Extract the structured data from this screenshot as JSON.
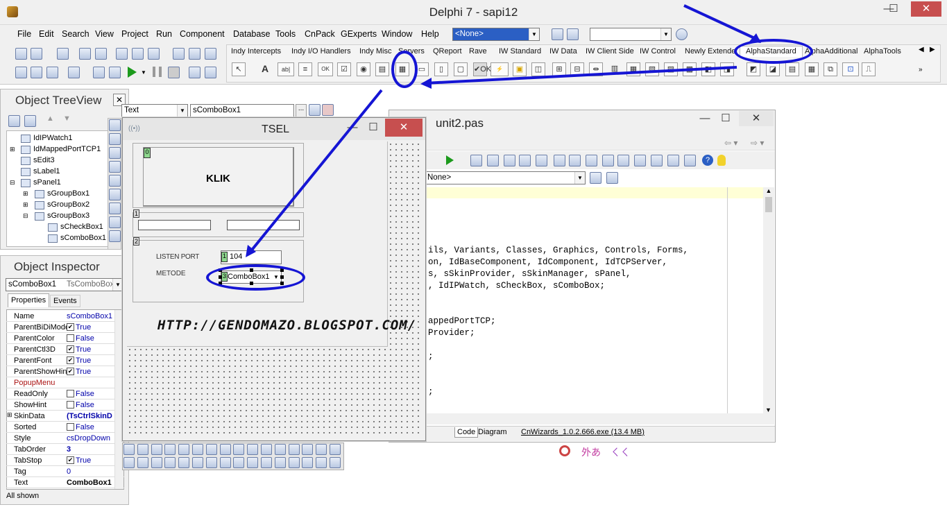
{
  "window": {
    "title": "Delphi 7 - sapi12",
    "minimize": "—",
    "maximize": "☐",
    "close": "✕"
  },
  "menu": [
    "File",
    "Edit",
    "Search",
    "View",
    "Project",
    "Run",
    "Component",
    "Database",
    "Tools",
    "CnPack",
    "GExperts",
    "Window",
    "Help"
  ],
  "toolbar": {
    "none_combo": "<None>",
    "empty_combo": ""
  },
  "palette": {
    "tabs": [
      "Indy Intercepts",
      "Indy I/O Handlers",
      "Indy Misc",
      "Servers",
      "QReport",
      "Rave",
      "IW Standard",
      "IW Data",
      "IW Client Side",
      "IW Control",
      "Newly Extended",
      "AlphaStandard",
      "AlphaAdditional",
      "AlphaTools"
    ],
    "active_tab": "AlphaStandard",
    "icons": [
      "↖",
      "A",
      "ab|",
      "≡",
      "OK",
      "☑",
      "◉",
      "▤",
      "▦",
      "▭",
      "▯",
      "▢",
      "✔OK",
      "⚡",
      "▣",
      "◫",
      "⊞",
      "⊟",
      "⇹",
      "▥",
      "▦",
      "▧",
      "▨",
      "▩",
      "◧",
      "◨",
      "◩",
      "◪",
      "▤",
      "▦",
      "⧉",
      "⊡",
      "⎍"
    ]
  },
  "object_treeview": {
    "title": "Object TreeView",
    "items": [
      "IdIPWatch1",
      "IdMappedPortTCP1",
      "sEdit3",
      "sLabel1",
      "sPanel1",
      "sGroupBox1",
      "sGroupBox2",
      "sGroupBox3",
      "sCheckBox1",
      "sComboBox1"
    ]
  },
  "object_inspector": {
    "title": "Object Inspector",
    "selected_name": "sComboBox1",
    "selected_type": "TsComboBox",
    "tabs": [
      "Properties",
      "Events"
    ],
    "rows": [
      {
        "name": "Name",
        "value": "sComboBox1",
        "check": false
      },
      {
        "name": "ParentBiDiMode",
        "value": "True",
        "check": true
      },
      {
        "name": "ParentColor",
        "value": "False",
        "check": false
      },
      {
        "name": "ParentCtl3D",
        "value": "True",
        "check": true
      },
      {
        "name": "ParentFont",
        "value": "True",
        "check": true
      },
      {
        "name": "ParentShowHint",
        "value": "True",
        "check": true
      },
      {
        "name": "PopupMenu",
        "value": "",
        "check": false
      },
      {
        "name": "ReadOnly",
        "value": "False",
        "check": false
      },
      {
        "name": "ShowHint",
        "value": "False",
        "check": false
      },
      {
        "name": "SkinData",
        "value": "(TsCtrlSkinD",
        "check": false
      },
      {
        "name": "Sorted",
        "value": "False",
        "check": false
      },
      {
        "name": "Style",
        "value": "csDropDown",
        "check": false
      },
      {
        "name": "TabOrder",
        "value": "3",
        "check": false
      },
      {
        "name": "TabStop",
        "value": "True",
        "check": true
      },
      {
        "name": "Tag",
        "value": "0",
        "check": false
      },
      {
        "name": "Text",
        "value": "ComboBox1",
        "check": false
      }
    ],
    "status": "All shown"
  },
  "prop_bar": {
    "prop": "Text",
    "value": "sComboBox1",
    "ellipsis": "..."
  },
  "tsel_form": {
    "title": "TSEL",
    "button_label": "KLIK",
    "listen_port_label": "LISTEN PORT",
    "metode_label": "METODE",
    "port_value": "104",
    "combo_value": "ComboBox1",
    "url_text": "HTTP://GENDOMAZO.BLOGSPOT.COM/",
    "tags": [
      "0",
      "1",
      "2",
      "1",
      "3"
    ]
  },
  "editor": {
    "title": "unit2.pas",
    "combo": "None>",
    "code_lines": [
      "ils, Variants, Classes, Graphics, Controls, Forms,",
      "on, IdBaseComponent, IdComponent, IdTCPServer,",
      "s, sSkinProvider, sSkinManager, sPanel,",
      ", IdIPWatch, sCheckBox, sComboBox;",
      "",
      "",
      "appedPortTCP;",
      "Provider;",
      "",
      ";",
      "",
      "",
      ";"
    ],
    "tabs": [
      "Code",
      "Diagram"
    ],
    "status": "CnWizards_1.0.2.666.exe (13.4 MB)"
  },
  "tray": [
    "外あ",
    "ㄑㄑ"
  ]
}
